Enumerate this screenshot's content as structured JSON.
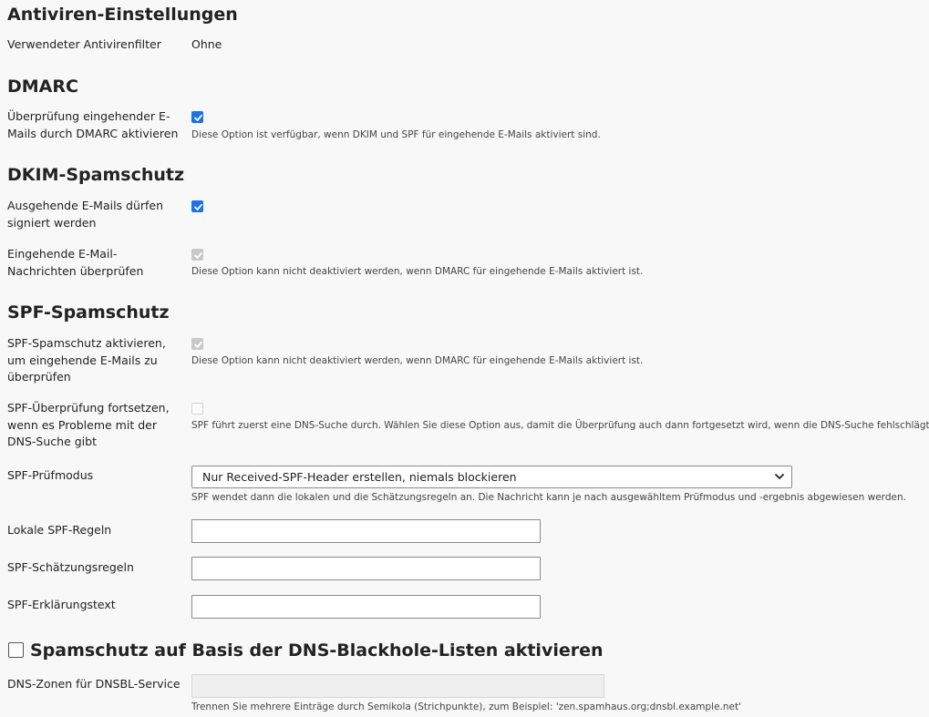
{
  "antivirus": {
    "title": "Antiviren-Einstellungen",
    "filter_label": "Verwendeter Antivirenfilter",
    "filter_value": "Ohne"
  },
  "dmarc": {
    "title": "DMARC",
    "enable_label": "Überprüfung eingehender E-Mails durch DMARC aktivieren",
    "enable_hint": "Diese Option ist verfügbar, wenn DKIM und SPF für eingehende E-Mails aktiviert sind.",
    "enable_checked": true
  },
  "dkim": {
    "title": "DKIM-Spamschutz",
    "sign_label": "Ausgehende E-Mails dürfen signiert werden",
    "sign_checked": true,
    "verify_label": "Eingehende E-Mail-Nachrichten überprüfen",
    "verify_hint": "Diese Option kann nicht deaktiviert werden, wenn DMARC für eingehende E-Mails aktiviert ist.",
    "verify_checked": true,
    "verify_disabled": true
  },
  "spf": {
    "title": "SPF-Spamschutz",
    "enable_label": "SPF-Spamschutz aktivieren, um eingehende E-Mails zu überprüfen",
    "enable_hint": "Diese Option kann nicht deaktiviert werden, wenn DMARC für eingehende E-Mails aktiviert ist.",
    "continue_label": "SPF-Überprüfung fortsetzen, wenn es Probleme mit der DNS-Suche gibt",
    "continue_hint": "SPF führt zuerst eine DNS-Suche durch. Wählen Sie diese Option aus, damit die Überprüfung auch dann fortgesetzt wird, wenn die DNS-Suche fehlschlägt.",
    "mode_label": "SPF-Prüfmodus",
    "mode_value": "Nur Received-SPF-Header erstellen, niemals blockieren",
    "mode_hint": "SPF wendet dann die lokalen und die Schätzungsregeln an. Die Nachricht kann je nach ausgewähltem Prüfmodus und -ergebnis abgewiesen werden.",
    "local_rules_label": "Lokale SPF-Regeln",
    "local_rules_value": "",
    "guess_rules_label": "SPF-Schätzungsregeln",
    "guess_rules_value": "",
    "explanation_label": "SPF-Erklärungstext",
    "explanation_value": ""
  },
  "dnsbl": {
    "title": "Spamschutz auf Basis der DNS-Blackhole-Listen aktivieren",
    "zones_label": "DNS-Zonen für DNSBL-Service",
    "zones_value": "",
    "zones_hint": "Trennen Sie mehrere Einträge durch Semikola (Strichpunkte), zum Beispiel: 'zen.spamhaus.org;dnsbl.example.net'"
  },
  "colors": {
    "accent": "#1a73e8",
    "disabled_check": "#c9c9c9",
    "background": "#f8f8f8"
  }
}
